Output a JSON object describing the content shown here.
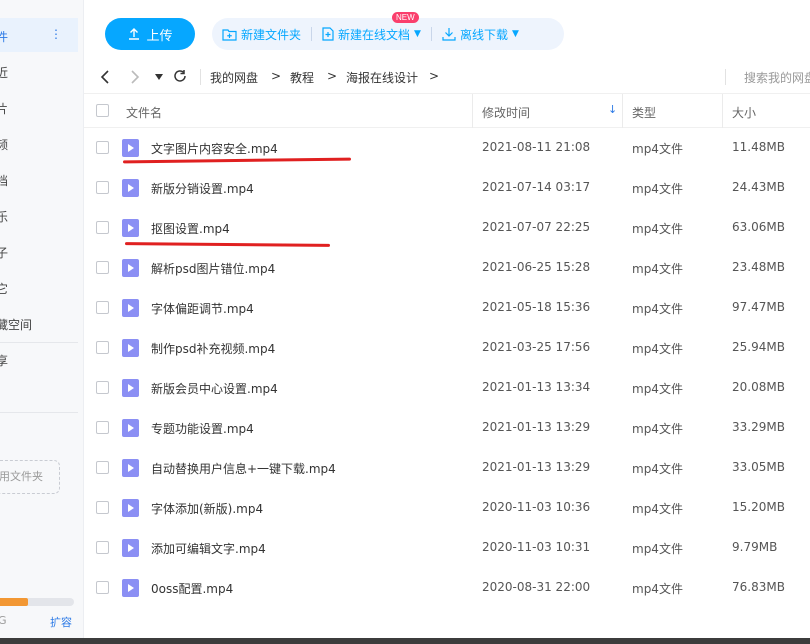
{
  "sidebar": {
    "items": [
      {
        "label": "件",
        "name": "sidebar-item-all-files"
      },
      {
        "label": "近",
        "name": "sidebar-item-recent"
      },
      {
        "label": "片",
        "name": "sidebar-item-images"
      },
      {
        "label": "频",
        "name": "sidebar-item-videos"
      },
      {
        "label": "档",
        "name": "sidebar-item-documents"
      },
      {
        "label": "乐",
        "name": "sidebar-item-music"
      },
      {
        "label": "子",
        "name": "sidebar-item-seeds"
      },
      {
        "label": "它",
        "name": "sidebar-item-other"
      },
      {
        "label": "藏空间",
        "name": "sidebar-item-hidden-space"
      },
      {
        "label": "享",
        "name": "sidebar-item-shares"
      },
      {
        "label": "]",
        "name": "sidebar-item-partial"
      }
    ],
    "active_dots": "⋮",
    "common_folder": "用文件夹",
    "quota_text": "G",
    "quota_fraction": 0.38,
    "expand_label": "扩容"
  },
  "toolbar": {
    "upload_label": "上传",
    "new_folder_label": "新建文件夹",
    "new_online_doc_label": "新建在线文档",
    "new_badge": "NEW",
    "offline_download_label": "离线下载"
  },
  "nav": {
    "breadcrumb": [
      "我的网盘",
      "教程",
      "海报在线设计"
    ],
    "separator": ">",
    "search_placeholder": "搜索我的网盘"
  },
  "table": {
    "columns": {
      "name": "文件名",
      "modified": "修改时间",
      "type": "类型",
      "size": "大小"
    },
    "rows": [
      {
        "name": "文字图片内容安全.mp4",
        "modified": "2021-08-11 21:08",
        "type": "mp4文件",
        "size": "11.48MB"
      },
      {
        "name": "新版分销设置.mp4",
        "modified": "2021-07-14 03:17",
        "type": "mp4文件",
        "size": "24.43MB"
      },
      {
        "name": "抠图设置.mp4",
        "modified": "2021-07-07 22:25",
        "type": "mp4文件",
        "size": "63.06MB"
      },
      {
        "name": "解析psd图片错位.mp4",
        "modified": "2021-06-25 15:28",
        "type": "mp4文件",
        "size": "23.48MB"
      },
      {
        "name": "字体偏距调节.mp4",
        "modified": "2021-05-18 15:36",
        "type": "mp4文件",
        "size": "97.47MB"
      },
      {
        "name": "制作psd补充视频.mp4",
        "modified": "2021-03-25 17:56",
        "type": "mp4文件",
        "size": "25.94MB"
      },
      {
        "name": "新版会员中心设置.mp4",
        "modified": "2021-01-13 13:34",
        "type": "mp4文件",
        "size": "20.08MB"
      },
      {
        "name": "专题功能设置.mp4",
        "modified": "2021-01-13 13:29",
        "type": "mp4文件",
        "size": "33.29MB"
      },
      {
        "name": "自动替换用户信息+一键下载.mp4",
        "modified": "2021-01-13 13:29",
        "type": "mp4文件",
        "size": "33.05MB"
      },
      {
        "name": "字体添加(新版).mp4",
        "modified": "2020-11-03 10:36",
        "type": "mp4文件",
        "size": "15.20MB"
      },
      {
        "name": "添加可编辑文字.mp4",
        "modified": "2020-11-03 10:31",
        "type": "mp4文件",
        "size": "9.79MB"
      },
      {
        "name": "0oss配置.mp4",
        "modified": "2020-08-31 22:00",
        "type": "mp4文件",
        "size": "76.83MB"
      }
    ]
  },
  "colors": {
    "accent": "#06a7ff",
    "file_icon": "#8b8ff4",
    "annotation": "#e02020",
    "quota_fill": "#f29733"
  }
}
